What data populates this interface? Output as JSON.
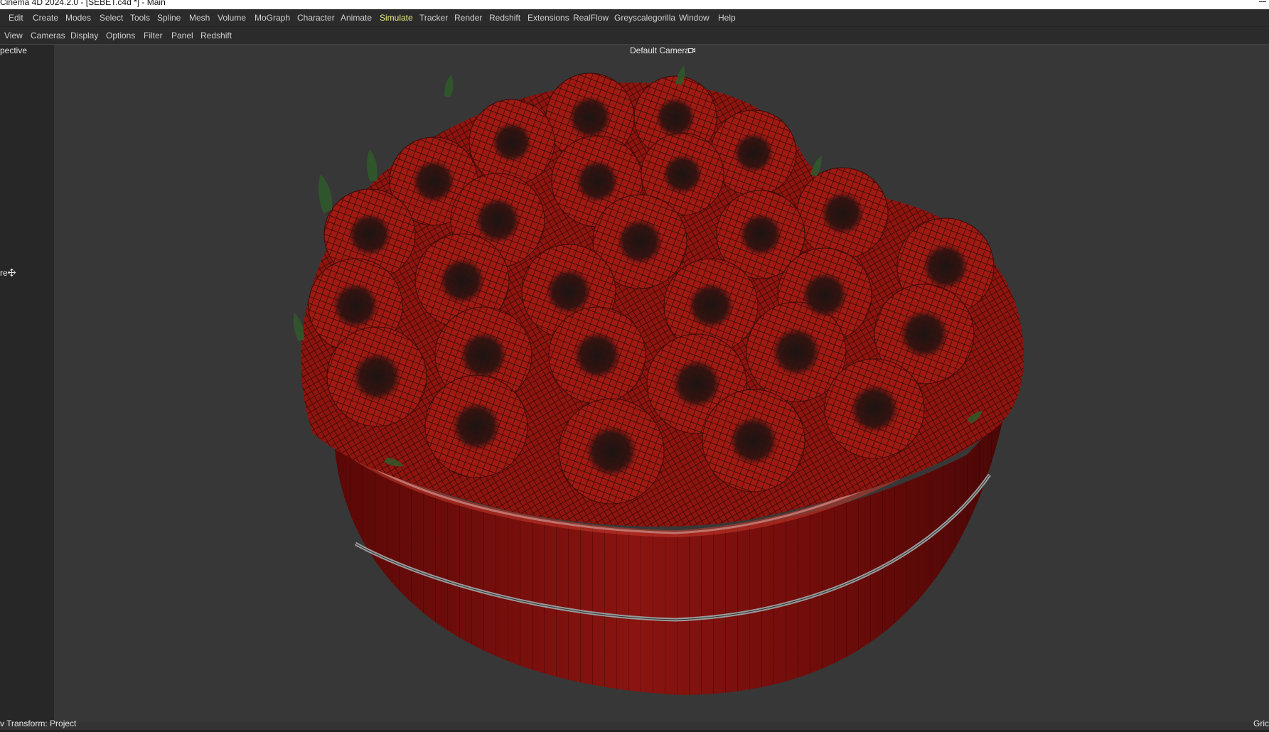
{
  "window": {
    "title": "Cinema 4D 2024.2.0 - [SEBET.c4d *] - Main"
  },
  "menubar": {
    "items": [
      {
        "label": "Edit"
      },
      {
        "label": "Create"
      },
      {
        "label": "Modes"
      },
      {
        "label": "Select"
      },
      {
        "label": "Tools"
      },
      {
        "label": "Spline"
      },
      {
        "label": "Mesh"
      },
      {
        "label": "Volume"
      },
      {
        "label": "MoGraph"
      },
      {
        "label": "Character"
      },
      {
        "label": "Animate"
      },
      {
        "label": "Simulate",
        "active": true
      },
      {
        "label": "Tracker"
      },
      {
        "label": "Render"
      },
      {
        "label": "Redshift"
      },
      {
        "label": "Extensions"
      },
      {
        "label": "RealFlow"
      },
      {
        "label": "Greyscalegorilla"
      },
      {
        "label": "Window"
      },
      {
        "label": "Help"
      }
    ]
  },
  "viewmenu": {
    "items": [
      {
        "label": "View"
      },
      {
        "label": "Cameras"
      },
      {
        "label": "Display"
      },
      {
        "label": "Options"
      },
      {
        "label": "Filter"
      },
      {
        "label": "Panel"
      },
      {
        "label": "Redshift"
      }
    ]
  },
  "viewport": {
    "name_label": "pective",
    "camera_label": "Default Camera",
    "side_label": "re",
    "status_left": "v Transform: Project",
    "status_right": "Gric"
  },
  "colors": {
    "accent_active_menu": "#e9e98a",
    "rose_red": "#a31a12",
    "box_red": "#7a0d0a",
    "viewport_bg": "#373737"
  }
}
